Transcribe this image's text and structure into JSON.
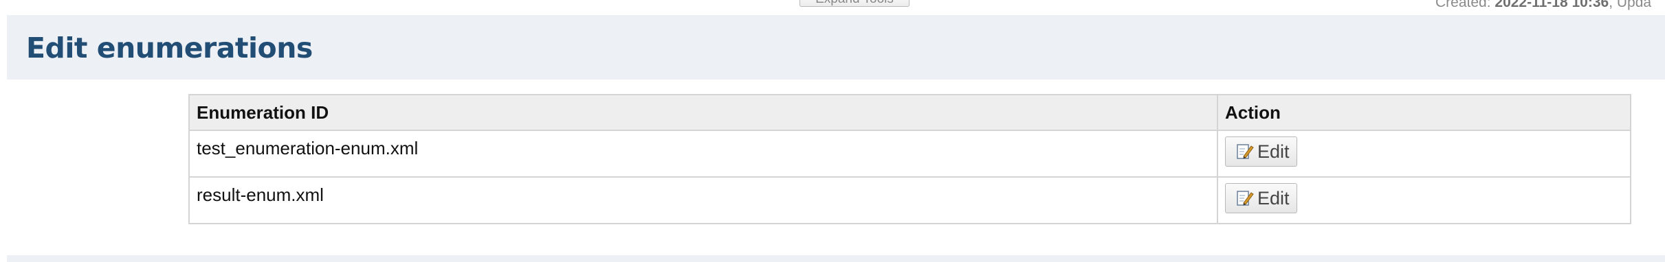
{
  "toolbar": {
    "expand_tools_label": "Expand Tools"
  },
  "meta": {
    "created_label": "Created: ",
    "created_value": "2022-11-18 10:36",
    "updated_label": ", Upda"
  },
  "page": {
    "title": "Edit enumerations"
  },
  "table": {
    "headers": [
      "Enumeration ID",
      "Action"
    ],
    "rows": [
      {
        "id": "test_enumeration-enum.xml",
        "action_label": "Edit"
      },
      {
        "id": "result-enum.xml",
        "action_label": "Edit"
      }
    ]
  },
  "icons": {
    "edit": "edit-pencil-icon"
  },
  "colors": {
    "title": "#224e76",
    "header_band": "#edf0f5",
    "table_header_bg": "#eeeeee",
    "border": "#d4d4d4"
  }
}
